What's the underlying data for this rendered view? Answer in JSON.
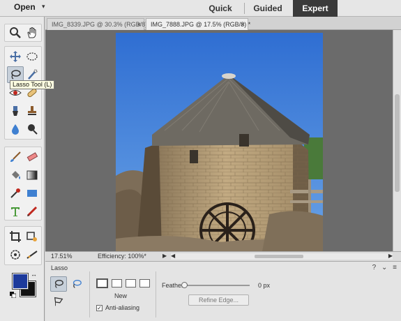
{
  "topbar": {
    "open_label": "Open",
    "open_caret": "▾",
    "modes": {
      "quick": "Quick",
      "guided": "Guided",
      "expert": "Expert"
    },
    "active_mode": "Expert"
  },
  "toolbox": {
    "tooltip": "Lasso Tool (L)",
    "foreground_color": "#1d3a9b",
    "background_color": "#111111",
    "swap_glyph": "↔"
  },
  "tabs": [
    {
      "label": "IMG_8339.JPG @ 30.3% (RGB/8)",
      "close": "×",
      "active": false
    },
    {
      "label": "IMG_7888.JPG @ 17.5% (RGB/8) *",
      "close": "×",
      "active": true
    }
  ],
  "status": {
    "zoom": "17.51%",
    "efficiency": "Efficiency: 100%*",
    "arrow": "▶",
    "scroll_left": "◀",
    "scroll_right": "▶"
  },
  "options": {
    "title": "Lasso",
    "help_icon": "?",
    "menu_icon": "≡",
    "new_label": "New",
    "anti_alias_label": "Anti-aliasing",
    "anti_alias_checked": "✓",
    "feather_label": "Feather:",
    "feather_value": "0 px",
    "feather_level": 0,
    "refine_label": "Refine Edge..."
  },
  "colors": {
    "accent": "#3a3a3a",
    "sky": "#3a7ad4",
    "thatch": "#6e6a62"
  }
}
